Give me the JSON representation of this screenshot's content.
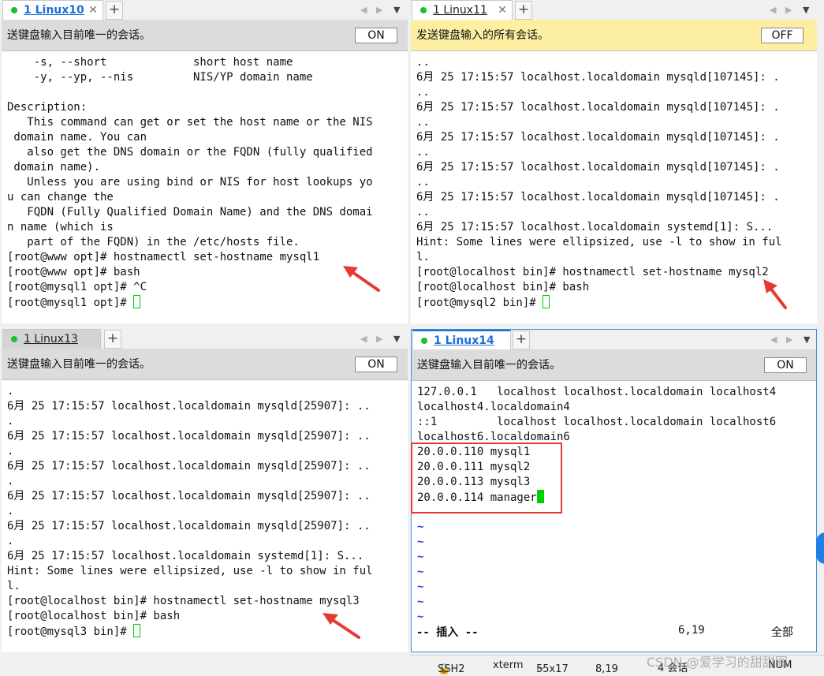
{
  "panes": [
    {
      "tab": {
        "label": "1 Linux10"
      },
      "broadcast": {
        "text": "送键盘输入目前唯一的会话。",
        "toggle": "ON"
      },
      "lines": [
        "    -s, --short             short host name",
        "    -y, --yp, --nis         NIS/YP domain name",
        "",
        "Description:",
        "   This command can get or set the host name or the NIS",
        " domain name. You can",
        "   also get the DNS domain or the FQDN (fully qualified",
        " domain name).",
        "   Unless you are using bind or NIS for host lookups yo",
        "u can change the",
        "   FQDN (Fully Qualified Domain Name) and the DNS domai",
        "n name (which is",
        "   part of the FQDN) in the /etc/hosts file.",
        "[root@www opt]# hostnamectl set-hostname mysql1",
        "[root@www opt]# bash",
        "[root@mysql1 opt]# ^C",
        "[root@mysql1 opt]# "
      ]
    },
    {
      "tab": {
        "label": "1 Linux11"
      },
      "broadcast": {
        "text": "发送键盘输入的所有会话。",
        "toggle": "OFF"
      },
      "lines": [
        "..",
        "6月 25 17:15:57 localhost.localdomain mysqld[107145]: .",
        "..",
        "6月 25 17:15:57 localhost.localdomain mysqld[107145]: .",
        "..",
        "6月 25 17:15:57 localhost.localdomain mysqld[107145]: .",
        "..",
        "6月 25 17:15:57 localhost.localdomain mysqld[107145]: .",
        "..",
        "6月 25 17:15:57 localhost.localdomain mysqld[107145]: .",
        "..",
        "6月 25 17:15:57 localhost.localdomain systemd[1]: S...",
        "Hint: Some lines were ellipsized, use -l to show in ful",
        "l.",
        "[root@localhost bin]# hostnamectl set-hostname mysql2",
        "[root@localhost bin]# bash",
        "[root@mysql2 bin]# "
      ]
    },
    {
      "tab": {
        "label": "1 Linux13"
      },
      "broadcast": {
        "text": "送键盘输入目前唯一的会话。",
        "toggle": "ON"
      },
      "lines": [
        ".",
        "6月 25 17:15:57 localhost.localdomain mysqld[25907]: ..",
        ".",
        "6月 25 17:15:57 localhost.localdomain mysqld[25907]: ..",
        ".",
        "6月 25 17:15:57 localhost.localdomain mysqld[25907]: ..",
        ".",
        "6月 25 17:15:57 localhost.localdomain mysqld[25907]: ..",
        ".",
        "6月 25 17:15:57 localhost.localdomain mysqld[25907]: ..",
        ".",
        "6月 25 17:15:57 localhost.localdomain systemd[1]: S...",
        "Hint: Some lines were ellipsized, use -l to show in ful",
        "l.",
        "[root@localhost bin]# hostnamectl set-hostname mysql3",
        "[root@localhost bin]# bash",
        "[root@mysql3 bin]# "
      ]
    },
    {
      "tab": {
        "label": "1 Linux14"
      },
      "broadcast": {
        "text": "送键盘输入目前唯一的会话。",
        "toggle": "ON"
      },
      "lines": [
        "127.0.0.1   localhost localhost.localdomain localhost4",
        "localhost4.localdomain4",
        "::1         localhost localhost.localdomain localhost6",
        "localhost6.localdomain6",
        "20.0.0.110 mysql1",
        "20.0.0.111 mysql2",
        "20.0.0.113 mysql3",
        "20.0.0.114 manager",
        "",
        "~",
        "~",
        "~",
        "~",
        "~",
        "~",
        "~"
      ],
      "vim_status": {
        "mode": "-- 插入 --",
        "position": "6,19",
        "scroll": "全部"
      }
    }
  ],
  "statusbar": {
    "protocol": "SSH2",
    "terminal": "xterm",
    "size": "55x17",
    "cursor_pos": "8,19",
    "sessions": "4 会话",
    "numlock": "NUM"
  },
  "watermark": "CSDN @爱学习的甜甜圈",
  "colors": {
    "accent_blue": "#1e6fd6",
    "arrow_red": "#e53935",
    "cursor_green": "#00d000"
  }
}
